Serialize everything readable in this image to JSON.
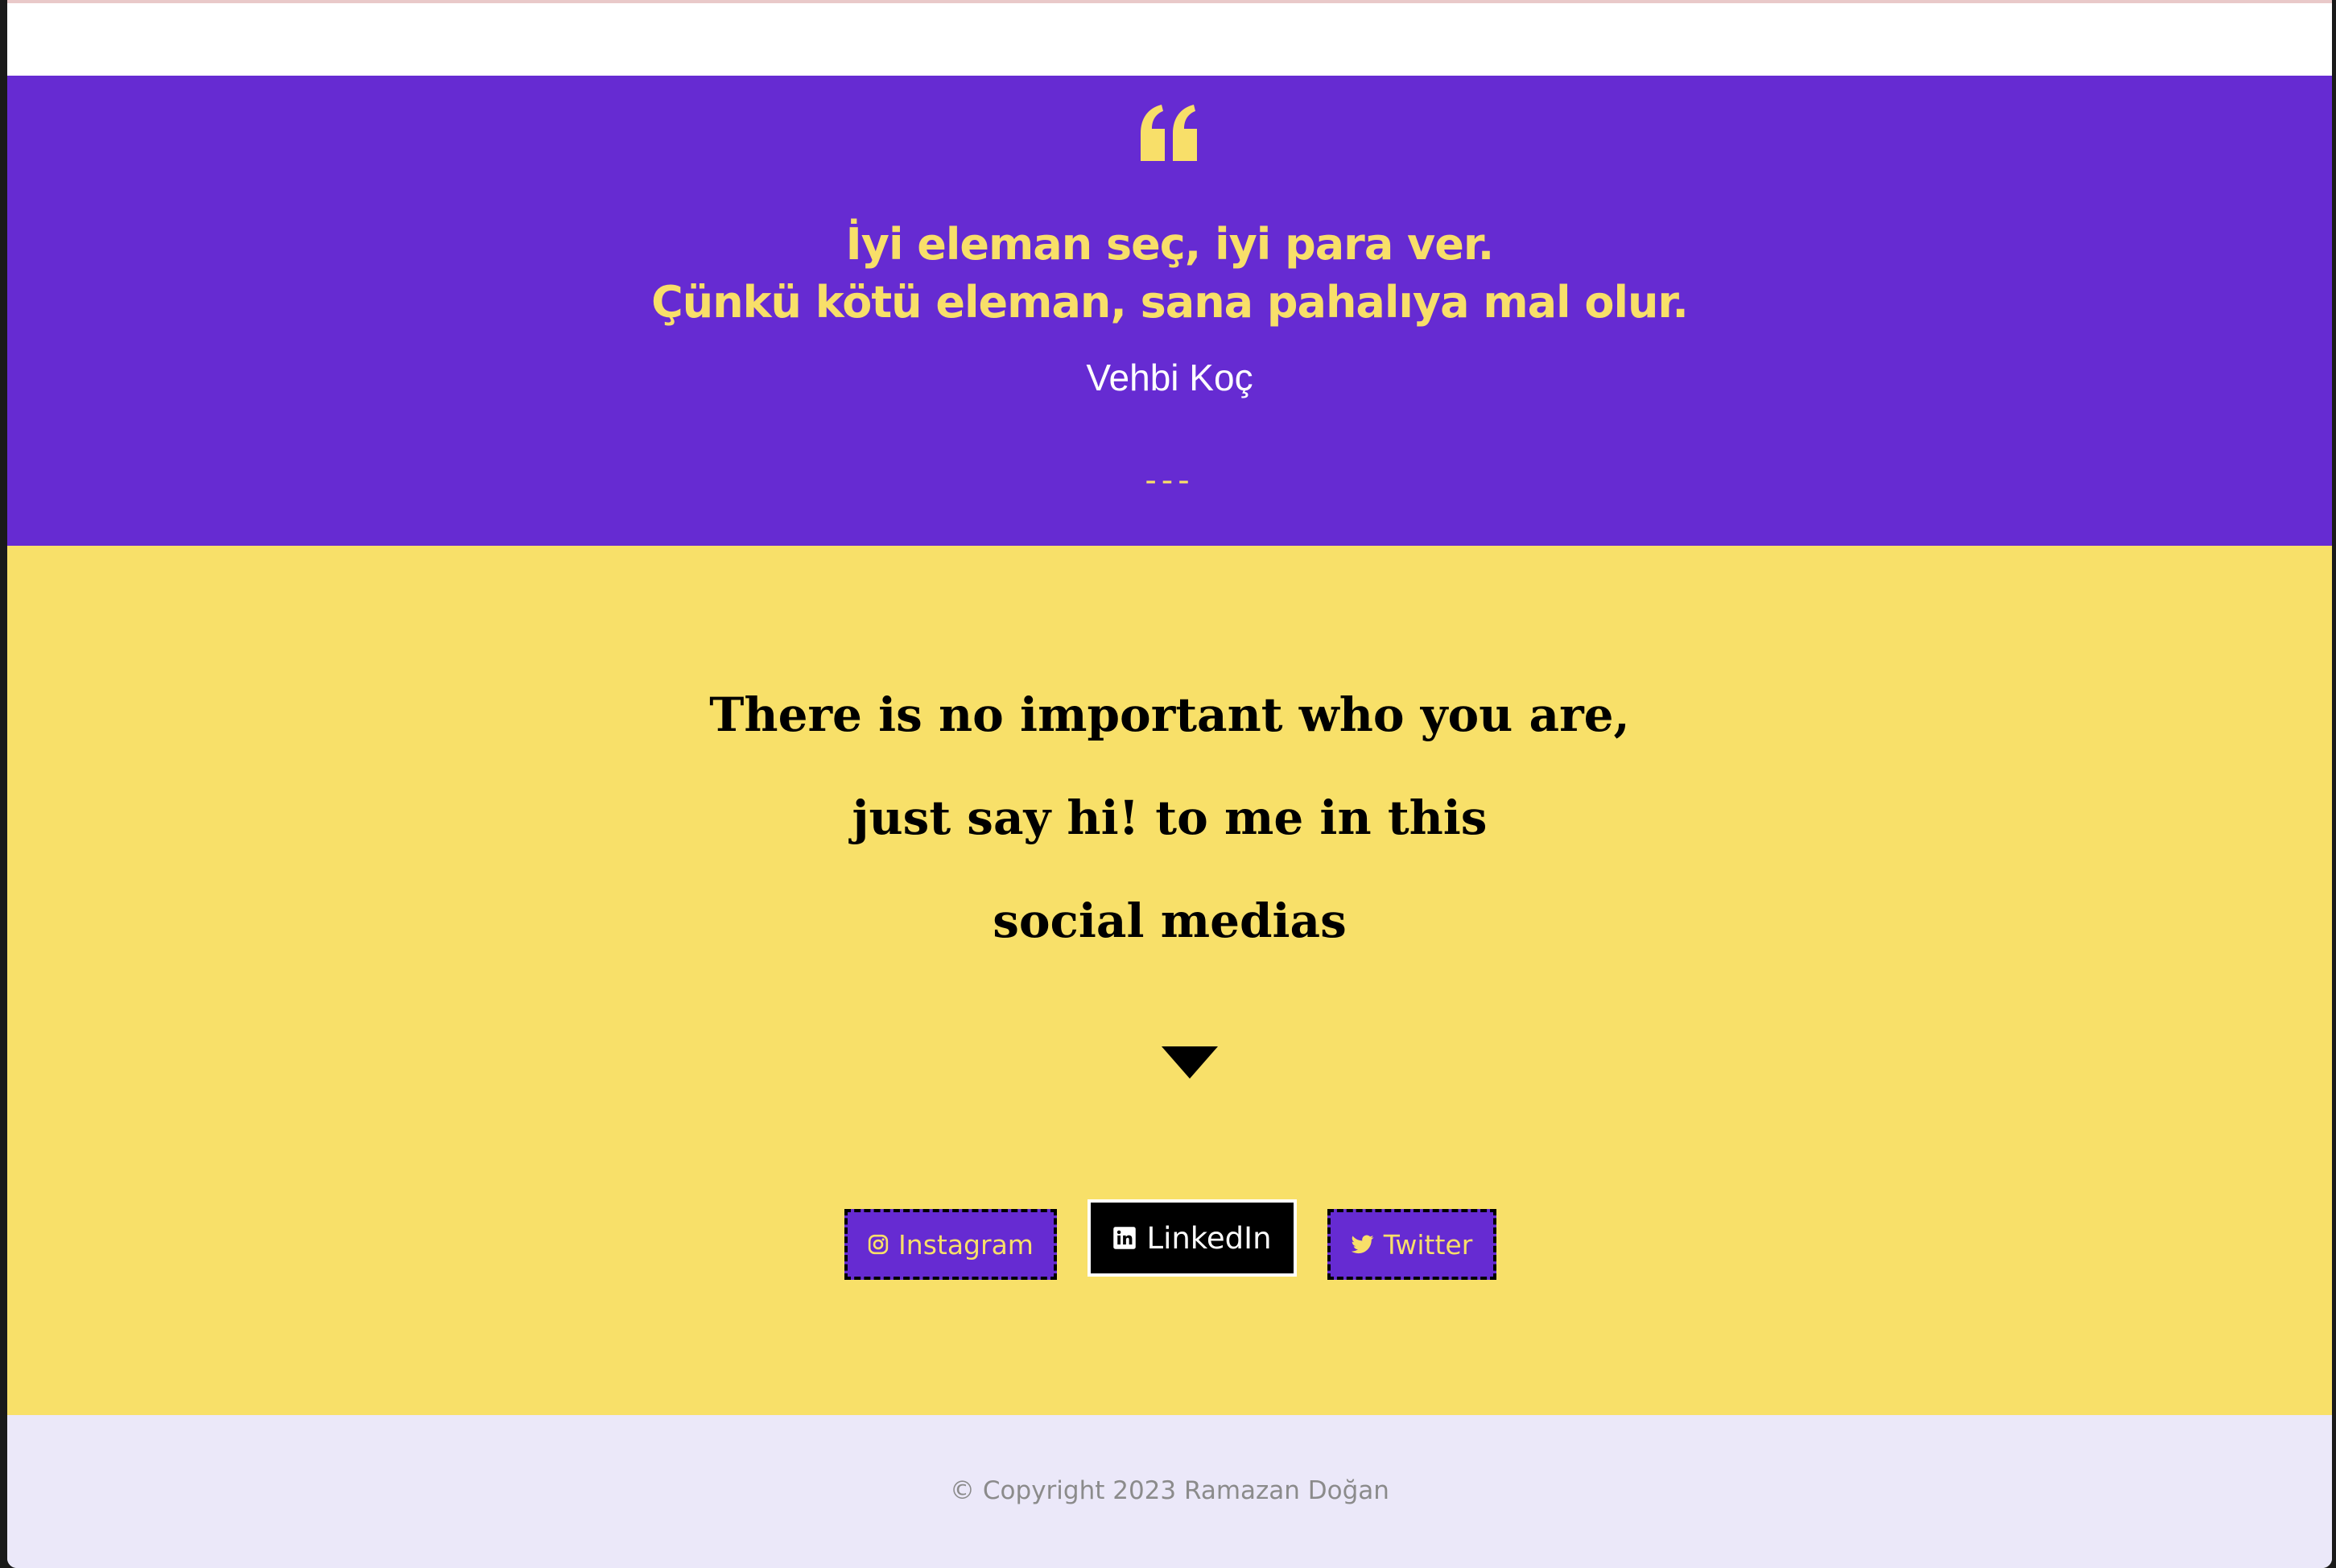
{
  "quote": {
    "lines": [
      "İyi eleman seç, iyi para ver.",
      "Çünkü kötü eleman, sana pahalıya mal olur."
    ],
    "author": "Vehbi Koç",
    "divider": "---",
    "icon": "quote-left-icon"
  },
  "social": {
    "heading_lines": [
      "There is no important who you are,",
      "just say hi! to me in this",
      "social medias"
    ],
    "arrow_icon": "caret-down-icon",
    "buttons": [
      {
        "label": "Instagram",
        "icon": "instagram-icon"
      },
      {
        "label": "LinkedIn",
        "icon": "linkedin-icon"
      },
      {
        "label": "Twitter",
        "icon": "twitter-icon"
      }
    ]
  },
  "footer": {
    "copyright": "© Copyright 2023 Ramazan Doğan"
  },
  "colors": {
    "purple": "#662bd2",
    "yellow": "#f8df69",
    "footer_bg": "#ebe8f9",
    "black": "#000000",
    "white": "#ffffff"
  }
}
